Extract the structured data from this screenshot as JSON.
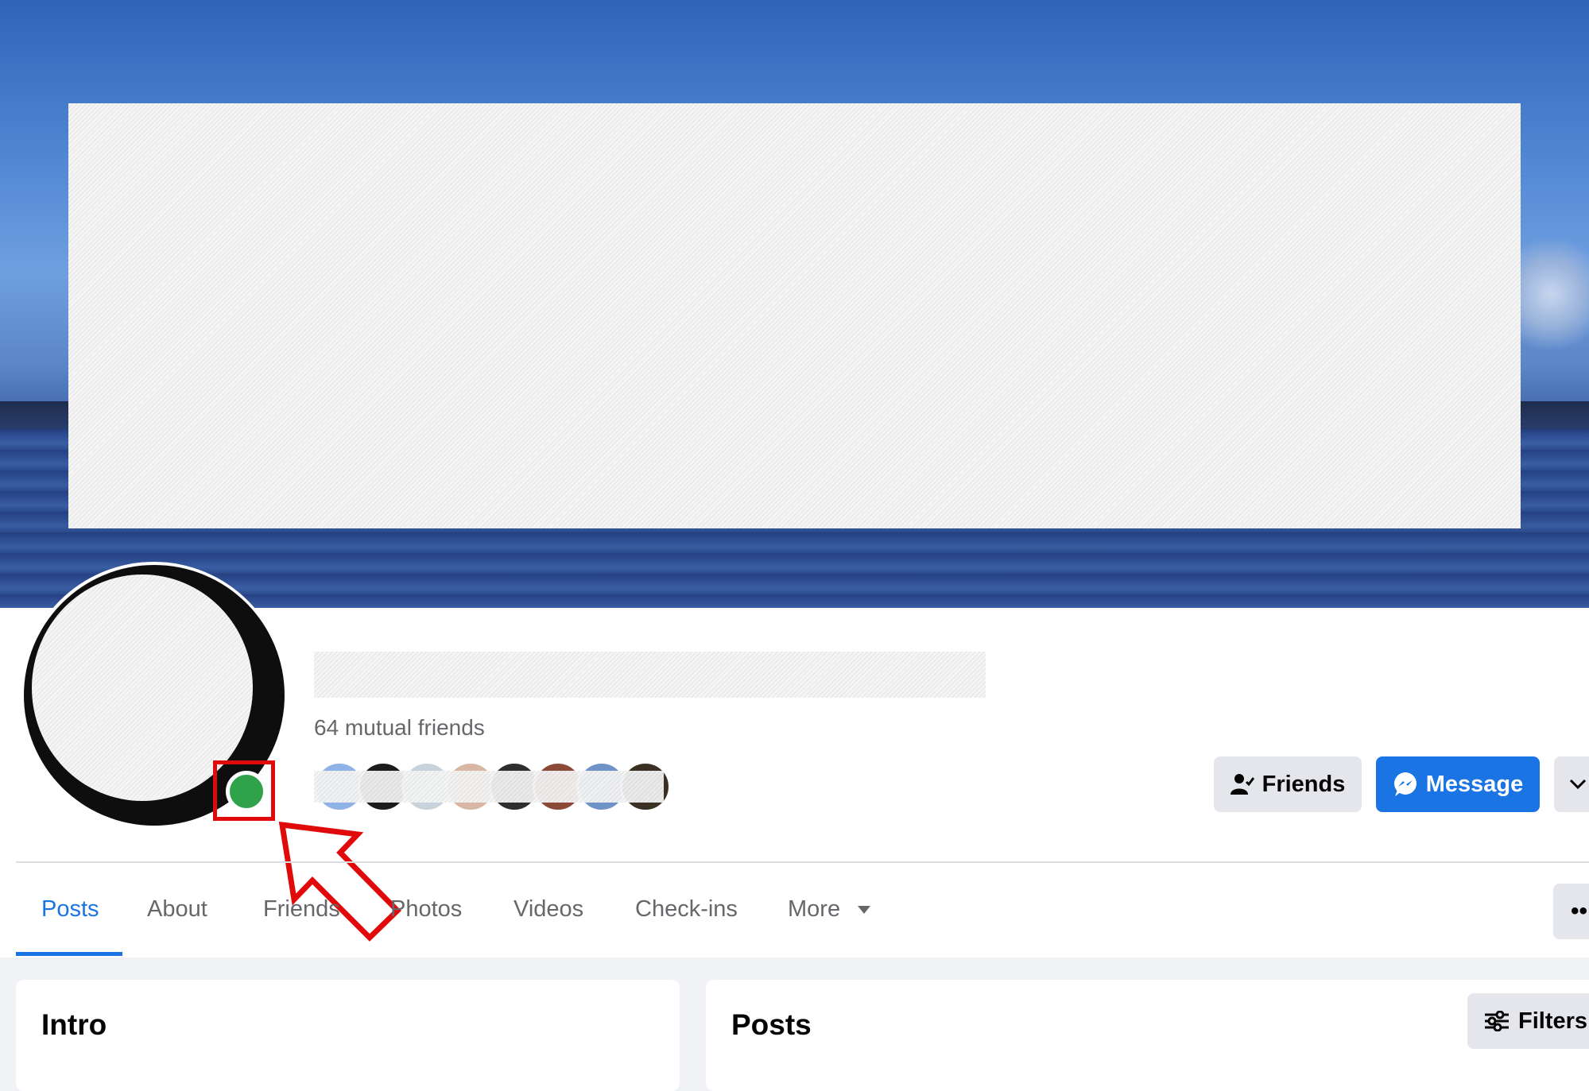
{
  "profile": {
    "mutual_friends": "64 mutual friends",
    "online_status_color": "#30a24a"
  },
  "actions": {
    "friends_label": "Friends",
    "message_label": "Message"
  },
  "tabs": [
    {
      "label": "Posts",
      "active": true
    },
    {
      "label": "About"
    },
    {
      "label": "Friends"
    },
    {
      "label": "Photos"
    },
    {
      "label": "Videos"
    },
    {
      "label": "Check-ins"
    },
    {
      "label": "More"
    }
  ],
  "tab_more_button": "••",
  "intro": {
    "title": "Intro"
  },
  "posts": {
    "title": "Posts",
    "filters_label": "Filters"
  },
  "annotation": {
    "color": "#e10a0a"
  },
  "colors": {
    "accent": "#1b74e4",
    "online": "#30a24a"
  }
}
